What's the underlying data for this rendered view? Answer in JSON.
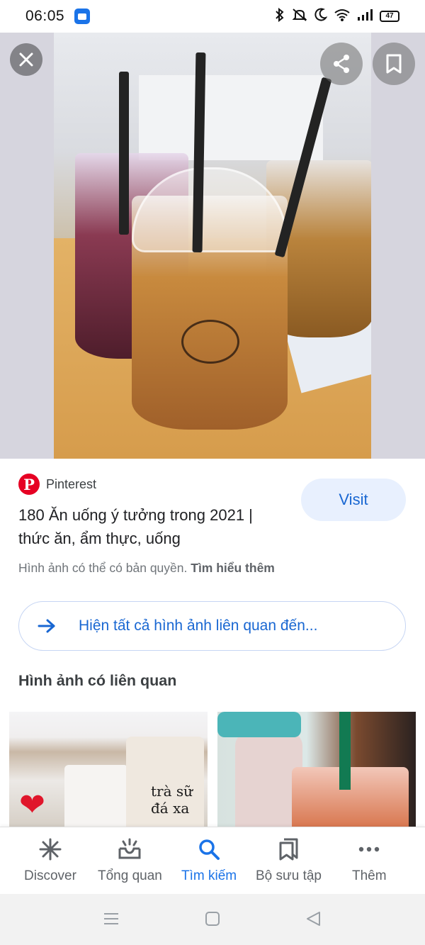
{
  "status_bar": {
    "time": "06:05",
    "battery": "47"
  },
  "viewer": {
    "close_icon": "close-icon",
    "share_icon": "share-icon",
    "bookmark_icon": "bookmark-icon"
  },
  "result": {
    "source_name": "Pinterest",
    "title": "180 Ăn uống ý tưởng trong 2021 | thức ăn, ẩm thực, uống",
    "visit_label": "Visit",
    "copyright_text": "Hình ảnh có thể có bản quyền.",
    "learn_more": "Tìm hiểu thêm",
    "related_link": "Hiện tất cả hình ảnh liên quan đến...",
    "related_title": "Hình ảnh có liên quan"
  },
  "thumbnails": [
    {
      "label": "trà sữ đá xa"
    },
    {
      "label": ""
    }
  ],
  "bottom_nav": {
    "items": [
      {
        "label": "Discover",
        "icon": "asterisk-icon"
      },
      {
        "label": "Tổng quan",
        "icon": "inbox-icon"
      },
      {
        "label": "Tìm kiếm",
        "icon": "search-icon",
        "active": true
      },
      {
        "label": "Bộ sưu tập",
        "icon": "collections-icon"
      },
      {
        "label": "Thêm",
        "icon": "more-dots-icon"
      }
    ]
  },
  "colors": {
    "accent": "#1a73e8",
    "pinterest": "#e60023",
    "visit_bg": "#e8f0fe"
  }
}
